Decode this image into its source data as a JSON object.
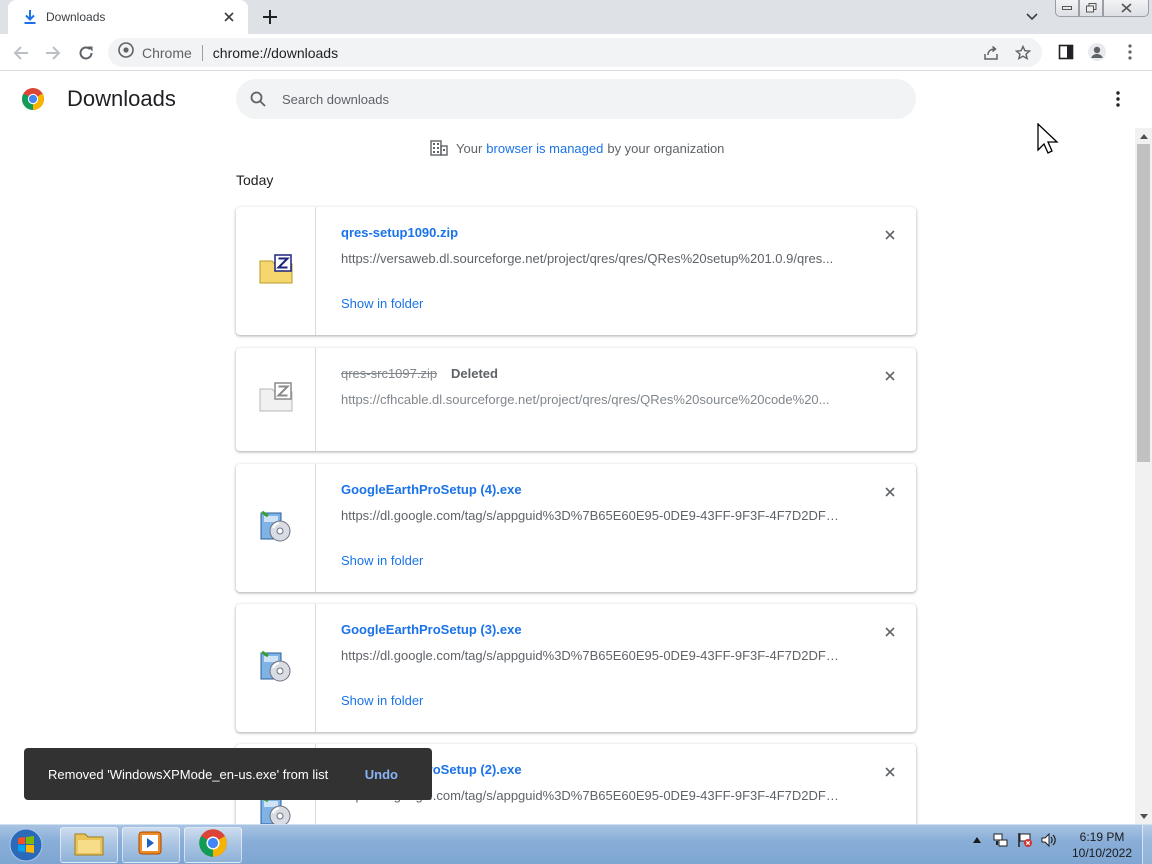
{
  "browser": {
    "tab_title": "Downloads",
    "omnibox_chip": "Chrome",
    "omnibox_url": "chrome://downloads"
  },
  "header": {
    "title": "Downloads",
    "search_placeholder": "Search downloads"
  },
  "managed_notice": {
    "prefix": "Your",
    "link": "browser is managed",
    "suffix": "by your organization"
  },
  "section_label": "Today",
  "downloads": [
    {
      "file_name": "qres-setup1090.zip",
      "url": "https://versaweb.dl.sourceforge.net/project/qres/qres/QRes%20setup%201.0.9/qres...",
      "action": "Show in folder",
      "icon": "zip-file-icon"
    },
    {
      "file_name": "qres-src1097.zip",
      "status": "Deleted",
      "url": "https://cfhcable.dl.sourceforge.net/project/qres/qres/QRes%20source%20code%20...",
      "icon": "zip-file-icon"
    },
    {
      "file_name": "GoogleEarthProSetup (4).exe",
      "url": "https://dl.google.com/tag/s/appguid%3D%7B65E60E95-0DE9-43FF-9F3F-4F7D2DFF...",
      "action": "Show in folder",
      "icon": "installer-icon"
    },
    {
      "file_name": "GoogleEarthProSetup (3).exe",
      "url": "https://dl.google.com/tag/s/appguid%3D%7B65E60E95-0DE9-43FF-9F3F-4F7D2DFF...",
      "action": "Show in folder",
      "icon": "installer-icon"
    },
    {
      "file_name": "GoogleEarthProSetup (2).exe",
      "url": "https://dl.google.com/tag/s/appguid%3D%7B65E60E95-0DE9-43FF-9F3F-4F7D2DFF...",
      "icon": "installer-icon"
    }
  ],
  "toast": {
    "message": "Removed 'WindowsXPMode_en-us.exe' from list",
    "action": "Undo"
  },
  "taskbar": {
    "time": "6:19 PM",
    "date": "10/10/2022"
  },
  "colors": {
    "link_blue": "#1a73e8",
    "tab_strip": "#dee1e6",
    "toast_bg": "#323232",
    "undo_blue": "#8ab4f8"
  }
}
